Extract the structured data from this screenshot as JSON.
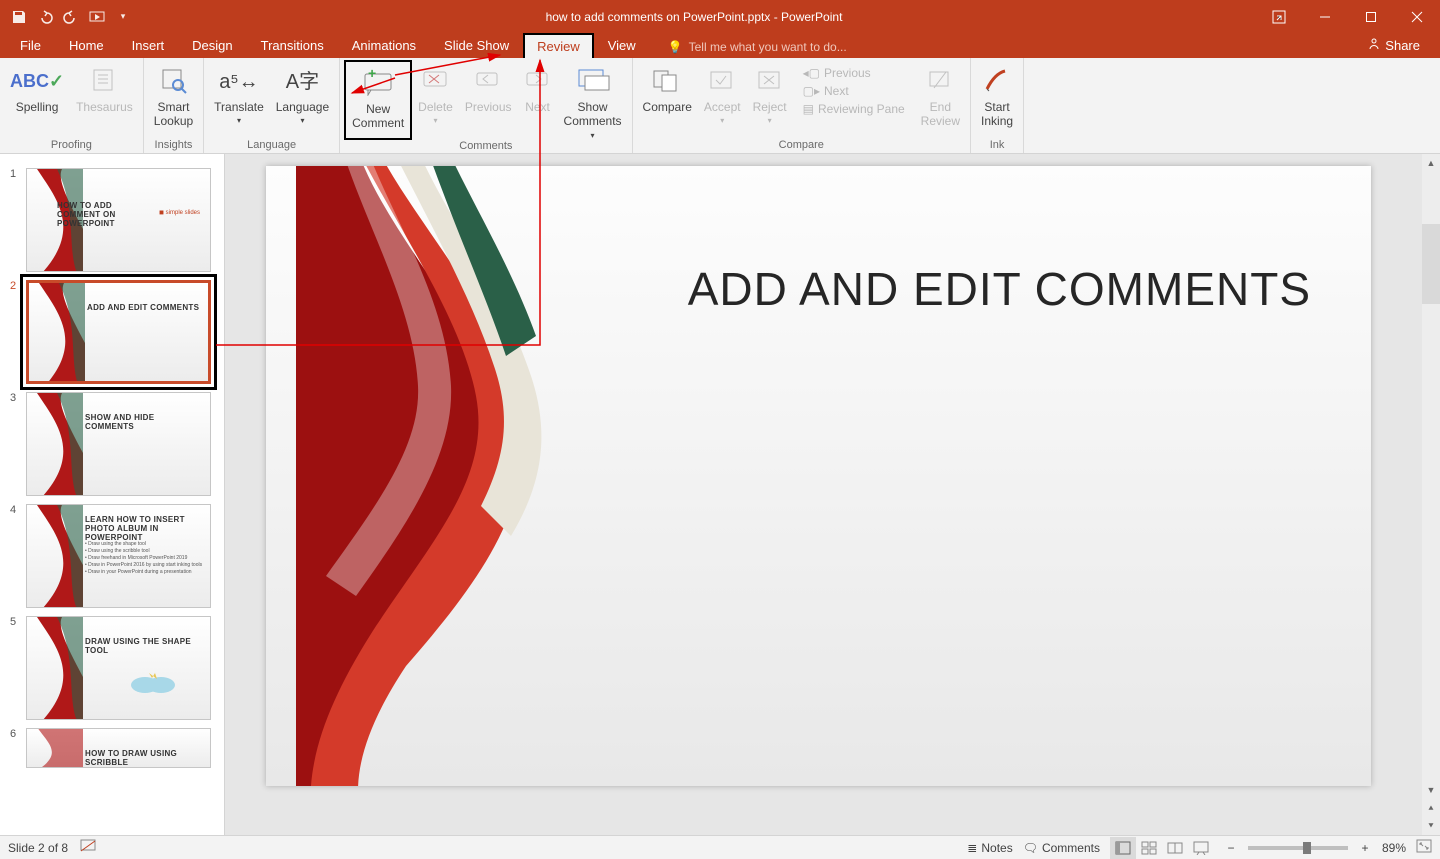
{
  "titlebar": {
    "document_title": "how to add comments on PowerPoint.pptx - PowerPoint"
  },
  "tabs": {
    "file": "File",
    "home": "Home",
    "insert": "Insert",
    "design": "Design",
    "transitions": "Transitions",
    "animations": "Animations",
    "slideshow": "Slide Show",
    "review": "Review",
    "view": "View",
    "tellme_placeholder": "Tell me what you want to do...",
    "share": "Share"
  },
  "ribbon": {
    "groups": {
      "proofing": {
        "label": "Proofing",
        "spelling": "Spelling",
        "thesaurus": "Thesaurus"
      },
      "insights": {
        "label": "Insights",
        "smart_lookup": "Smart\nLookup"
      },
      "language": {
        "label": "Language",
        "translate": "Translate",
        "language_btn": "Language"
      },
      "comments": {
        "label": "Comments",
        "new_comment": "New\nComment",
        "delete": "Delete",
        "previous": "Previous",
        "next": "Next",
        "show_comments": "Show\nComments"
      },
      "compare": {
        "label": "Compare",
        "compare": "Compare",
        "accept": "Accept",
        "reject": "Reject",
        "prev": "Previous",
        "next": "Next",
        "reviewing_pane": "Reviewing Pane",
        "end_review": "End\nReview"
      },
      "ink": {
        "label": "Ink",
        "start_inking": "Start\nInking"
      }
    }
  },
  "thumbnails": [
    {
      "num": "1",
      "title": "HOW TO ADD COMMENT ON POWERPOINT"
    },
    {
      "num": "2",
      "title": "ADD AND EDIT COMMENTS"
    },
    {
      "num": "3",
      "title": "SHOW AND HIDE COMMENTS"
    },
    {
      "num": "4",
      "title": "LEARN HOW TO INSERT PHOTO ALBUM IN POWERPOINT"
    },
    {
      "num": "5",
      "title": "DRAW USING THE SHAPE TOOL"
    },
    {
      "num": "6",
      "title": "HOW TO DRAW USING SCRIBBLE"
    }
  ],
  "slide": {
    "title": "ADD AND EDIT COMMENTS"
  },
  "status": {
    "slide_info": "Slide 2 of 8",
    "notes": "Notes",
    "comments": "Comments",
    "zoom": "89%"
  }
}
